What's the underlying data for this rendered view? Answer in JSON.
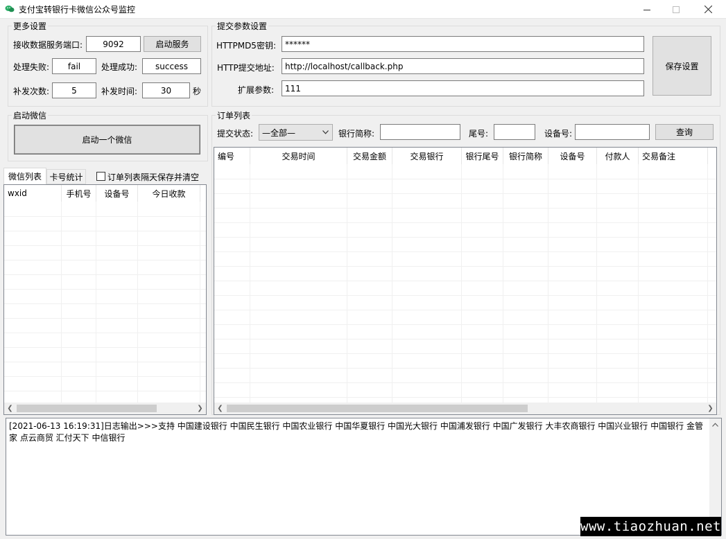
{
  "window": {
    "title": "支付宝转银行卡微信公众号监控",
    "icon": "wechat-app-icon",
    "controls": [
      "minimize-icon",
      "maximize-icon",
      "close-icon"
    ]
  },
  "more_settings": {
    "title": "更多设置",
    "port_label": "接收数据服务端口:",
    "port_value": "9092",
    "start_service_label": "启动服务",
    "fail_label": "处理失败:",
    "fail_value": "fail",
    "success_label": "处理成功:",
    "success_value": "success",
    "retry_count_label": "补发次数:",
    "retry_count_value": "5",
    "retry_time_label": "补发时间:",
    "retry_time_value": "30",
    "seconds_unit": "秒"
  },
  "submit_settings": {
    "title": "提交参数设置",
    "md5_label": "HTTPMD5密钥:",
    "md5_value": "******",
    "url_label": "HTTP提交地址:",
    "url_value": "http://localhost/callback.php",
    "ext_label": "扩展参数:",
    "ext_value": "111",
    "save_label": "保存设置"
  },
  "wechat_start": {
    "title": "启动微信",
    "start_one_label": "启动一个微信"
  },
  "left_tabs": {
    "tabs": [
      "微信列表",
      "卡号统计"
    ],
    "active": 0,
    "clear_checkbox_label": "订单列表隔天保存并清空",
    "clear_checked": false
  },
  "wechat_list": {
    "columns": [
      "wxid",
      "手机号",
      "设备号",
      "今日收款"
    ],
    "rows": []
  },
  "orders": {
    "title": "订单列表",
    "status_label": "提交状态:",
    "status_value": "—全部—",
    "bank_abbr_label": "银行简称:",
    "bank_abbr_value": "",
    "tail_label": "尾号:",
    "tail_value": "",
    "device_label": "设备号:",
    "device_value": "",
    "query_label": "查询",
    "columns": [
      "编号",
      "交易时间",
      "交易金额",
      "交易银行",
      "银行尾号",
      "银行简称",
      "设备号",
      "付款人",
      "交易备注"
    ],
    "rows": []
  },
  "log": {
    "text": "[2021-06-13 16:19:31]日志输出>>>支持 中国建设银行  中国民生银行  中国农业银行  中国华夏银行  中国光大银行  中国浦发银行  中国广发银行  大丰农商银行  中国兴业银行 中国银行  金管家 点云商贸 汇付天下 中信银行"
  },
  "watermark": "www.tiaozhuan.net"
}
